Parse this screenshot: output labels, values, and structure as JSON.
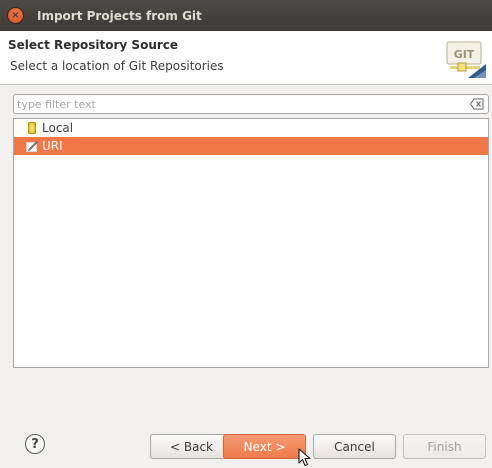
{
  "window": {
    "title": "Import Projects from Git",
    "close_glyph": "×"
  },
  "banner": {
    "title": "Select Repository Source",
    "description": "Select a location of Git Repositories",
    "logo_text": "GIT"
  },
  "filter": {
    "value": "",
    "placeholder": "type filter text"
  },
  "tree": {
    "items": [
      {
        "label": "Local",
        "icon": "repository-icon",
        "selected": false
      },
      {
        "label": "URI",
        "icon": "uri-icon",
        "selected": true
      }
    ]
  },
  "footer": {
    "help_glyph": "?",
    "back_label": "< Back",
    "next_label": "Next >",
    "cancel_label": "Cancel",
    "finish_label": "Finish"
  },
  "colors": {
    "selection": "#f07746",
    "titlebar": "#3c3b37",
    "dialog_bg": "#f2f1f0"
  }
}
